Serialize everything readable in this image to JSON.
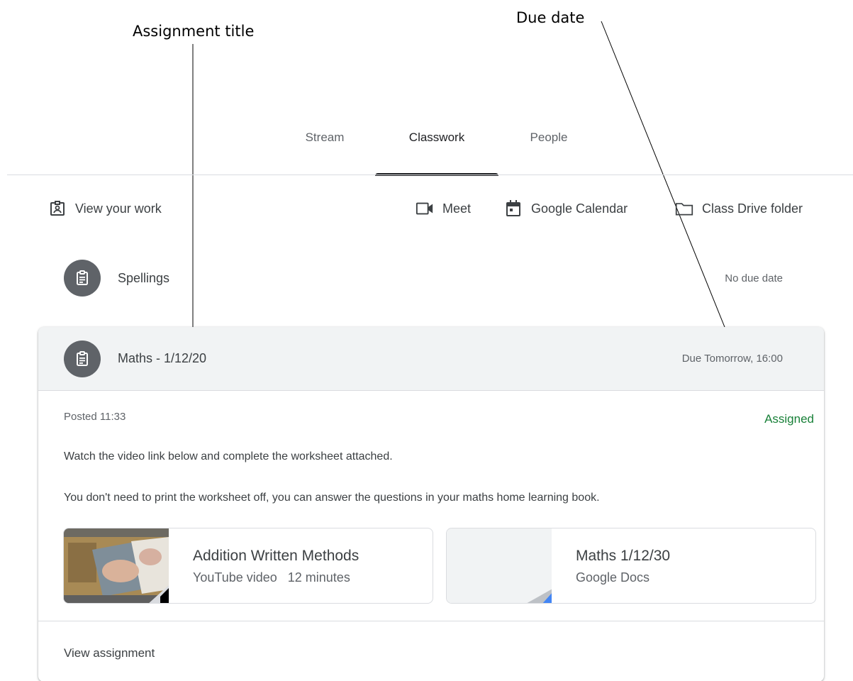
{
  "annotations": {
    "assignment_title": "Assignment title",
    "due_date": "Due date"
  },
  "tabs": [
    {
      "label": "Stream",
      "active": false
    },
    {
      "label": "Classwork",
      "active": true
    },
    {
      "label": "People",
      "active": false
    }
  ],
  "toolbar": {
    "view_work": "View your work",
    "meet": "Meet",
    "calendar": "Google Calendar",
    "drive": "Class Drive folder"
  },
  "assignments": [
    {
      "title": "Spellings",
      "due": "No due date",
      "icon": "assignment-icon"
    },
    {
      "title": "Maths - 1/12/20",
      "due": "Due Tomorrow, 16:00",
      "icon": "assignment-icon",
      "expanded": true
    }
  ],
  "expanded": {
    "posted": "Posted 11:33",
    "status": "Assigned",
    "description": [
      "Watch the video link below and complete the worksheet attached.",
      "You don't need to print the worksheet off, you can answer the questions in your maths home learning book."
    ],
    "attachments": [
      {
        "title": "Addition Written Methods",
        "subtitle": "YouTube video   12 minutes",
        "icon": "video-thumbnail"
      },
      {
        "title": "Maths 1/12/30",
        "subtitle": "Google Docs",
        "icon": "docs-thumbnail"
      }
    ],
    "view_link": "View assignment"
  },
  "colors": {
    "status_green": "#188038",
    "docs_blue": "#4285f4",
    "header_grey": "#f1f3f4"
  }
}
